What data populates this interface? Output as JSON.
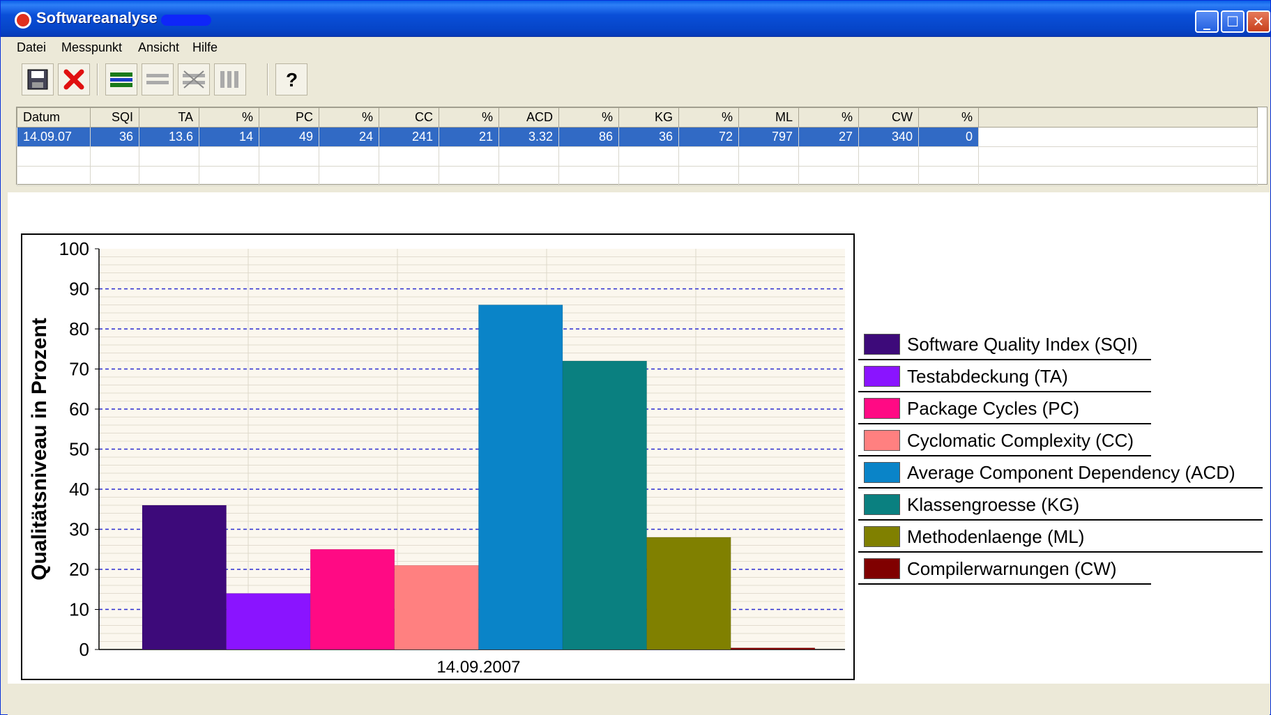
{
  "window": {
    "title": "Softwareanalyse"
  },
  "menu": [
    "Datei",
    "Messpunkt",
    "Ansicht",
    "Hilfe"
  ],
  "toolbar": {
    "icons": [
      "save-icon",
      "delete-icon",
      "rows-icon",
      "rows-split-icon",
      "chart-off-icon",
      "columns-icon",
      "help-icon"
    ]
  },
  "table": {
    "headers": [
      "Datum",
      "SQI",
      "TA",
      "%",
      "PC",
      "%",
      "CC",
      "%",
      "ACD",
      "%",
      "KG",
      "%",
      "ML",
      "%",
      "CW",
      "%"
    ],
    "rows": [
      [
        "14.09.07",
        "36",
        "13.6",
        "14",
        "49",
        "24",
        "241",
        "21",
        "3.32",
        "86",
        "36",
        "72",
        "797",
        "27",
        "340",
        "0"
      ]
    ]
  },
  "chart_data": {
    "type": "bar",
    "categories": [
      "14.09.2007"
    ],
    "ylabel": "Qualitätsniveau in Prozent",
    "xlabel": "",
    "ylim": [
      0,
      100
    ],
    "yticks": [
      "0",
      "10",
      "20",
      "30",
      "40",
      "50",
      "60",
      "70",
      "80",
      "90",
      "100"
    ],
    "grid": true,
    "legend_position": "right",
    "series": [
      {
        "name": "Software Quality Index (SQI)",
        "values": [
          36
        ],
        "color": "#3d0a7a"
      },
      {
        "name": "Testabdeckung (TA)",
        "values": [
          14
        ],
        "color": "#8a14ff"
      },
      {
        "name": "Package Cycles (PC)",
        "values": [
          25
        ],
        "color": "#ff0a84"
      },
      {
        "name": "Cyclomatic Complexity (CC)",
        "values": [
          21
        ],
        "color": "#ff8080"
      },
      {
        "name": "Average Component Dependency (ACD)",
        "values": [
          86
        ],
        "color": "#0a84c8"
      },
      {
        "name": "Klassengroesse (KG)",
        "values": [
          72
        ],
        "color": "#0a8080"
      },
      {
        "name": "Methodenlaenge (ML)",
        "values": [
          28
        ],
        "color": "#808000"
      },
      {
        "name": "Compilerwarnungen (CW)",
        "values": [
          0.4
        ],
        "color": "#800000"
      }
    ]
  }
}
